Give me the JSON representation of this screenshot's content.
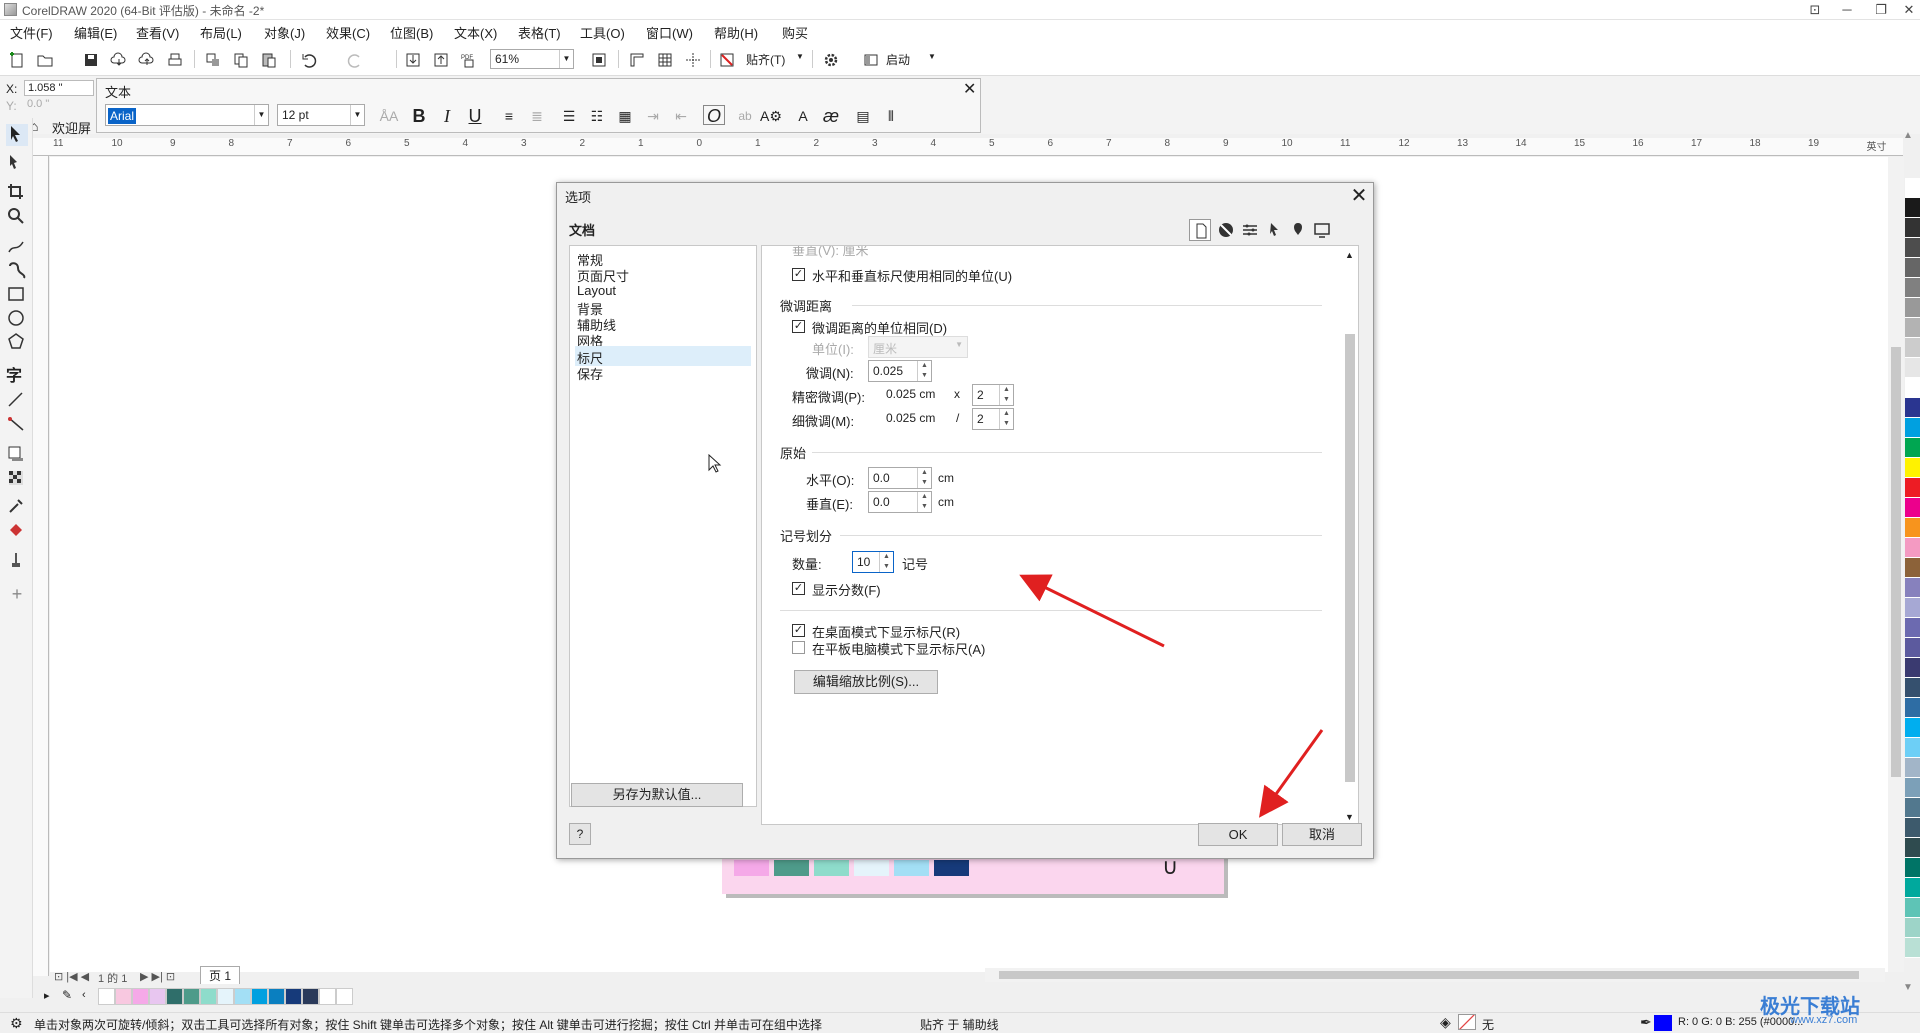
{
  "window": {
    "title": "CorelDRAW 2020 (64-Bit 评估版) - 未命名 -2*"
  },
  "menu": [
    "文件(F)",
    "编辑(E)",
    "查看(V)",
    "布局(L)",
    "对象(J)",
    "效果(C)",
    "位图(B)",
    "文本(X)",
    "表格(T)",
    "工具(O)",
    "窗口(W)",
    "帮助(H)",
    "购买"
  ],
  "toolbar": {
    "zoom": "61%",
    "snap_label": "贴齐(T)",
    "launch_label": "启动"
  },
  "coords": {
    "x_label": "X:",
    "x_value": "1.058 \"",
    "y_label": "Y:",
    "y_value": "0.0 \""
  },
  "text_panel": {
    "title": "文本",
    "font": "Arial",
    "size": "12 pt"
  },
  "welcome_tab": "欢迎屏",
  "ruler_h": [
    "11",
    "10",
    "9",
    "8",
    "7",
    "6",
    "5",
    "4",
    "3",
    "2",
    "1",
    "0",
    "1",
    "2",
    "3",
    "4",
    "5",
    "6",
    "7",
    "8",
    "9",
    "10",
    "11",
    "12",
    "13",
    "14",
    "15",
    "16",
    "17",
    "18",
    "19",
    "英寸"
  ],
  "dialog": {
    "title": "选项",
    "section": "文档",
    "nav": [
      "常规",
      "页面尺寸",
      "Layout",
      "背景",
      "辅助线",
      "网格",
      "标尺",
      "保存"
    ],
    "active_nav": "标尺",
    "save_default": "另存为默认值...",
    "help": "?",
    "ok": "OK",
    "cancel": "取消",
    "pane": {
      "partial_top": "垂直(V): 厘米",
      "same_units": "水平和垂直标尺使用相同的单位(U)",
      "nudge_group": "微调距离",
      "nudge_same_unit": "微调距离的单位相同(D)",
      "unit_label": "单位(I):",
      "unit_value": "厘米",
      "nudge_label": "微调(N):",
      "nudge_value": "0.025",
      "super_nudge_label": "精密微调(P):",
      "super_nudge_value": "0.025 cm",
      "super_nudge_op": "x",
      "super_nudge_mult": "2",
      "micro_nudge_label": "细微调(M):",
      "micro_nudge_value": "0.025 cm",
      "micro_nudge_op": "/",
      "micro_nudge_div": "2",
      "origin_group": "原始",
      "horiz_label": "水平(O):",
      "horiz_value": "0.0",
      "vert_label": "垂直(E):",
      "vert_value": "0.0",
      "cm": "cm",
      "tick_group": "记号划分",
      "count_label": "数量:",
      "count_value": "10",
      "count_unit": "记号",
      "show_fractions": "显示分数(F)",
      "desktop_show": "在桌面模式下显示标尺(R)",
      "tablet_show": "在平板电脑模式下显示标尺(A)",
      "edit_scale": "编辑缩放比例(S)..."
    }
  },
  "page_nav": {
    "page_counter": "1 的 1",
    "page_tab": "页 1"
  },
  "status": {
    "hint": "单击对象两次可旋转/倾斜；双击工具可选择所有对象；按住 Shift 键单击可选择多个对象；按住 Alt 键单击可进行挖掘；按住 Ctrl 并单击可在组中选择",
    "snap": "贴齐 于 辅助线",
    "fill_none": "无",
    "rgb": "R: 0 G: 0 B: 255 (#0000..."
  },
  "watermark": {
    "text": "极光下载站",
    "url": "www.xz7.com"
  },
  "colors": {
    "accent": "#0a64c8",
    "selection": "#ddeefa",
    "arrow": "#e02020"
  }
}
